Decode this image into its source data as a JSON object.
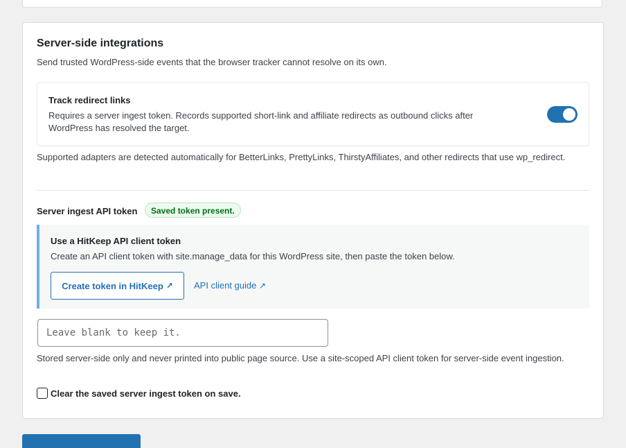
{
  "section": {
    "title": "Server-side integrations",
    "description": "Send trusted WordPress-side events that the browser tracker cannot resolve on its own."
  },
  "redirect_toggle": {
    "title": "Track redirect links",
    "description": "Requires a server ingest token. Records supported short-link and affiliate redirects as outbound clicks after WordPress has resolved the target.",
    "enabled": true
  },
  "adapters_note": "Supported adapters are detected automatically for BetterLinks, PrettyLinks, ThirstyAffiliates, and other redirects that use wp_redirect.",
  "token": {
    "label": "Server ingest API token",
    "badge": "Saved token present.",
    "notice_title": "Use a HitKeep API client token",
    "notice_description": "Create an API client token with site.manage_data for this WordPress site, then paste the token below.",
    "create_button": "Create token in HitKeep",
    "guide_link": "API client guide",
    "external_glyph": "↗",
    "input_placeholder": "Leave blank to keep it.",
    "input_value": "",
    "help_text": "Stored server-side only and never printed into public page source. Use a site-scoped API client token for server-side event ingestion.",
    "clear_label": "Clear the saved server ingest token on save."
  },
  "colors": {
    "accent": "#2271b1",
    "notice_border": "#72aee6",
    "badge_text": "#007017",
    "badge_bg": "#edfaef"
  }
}
